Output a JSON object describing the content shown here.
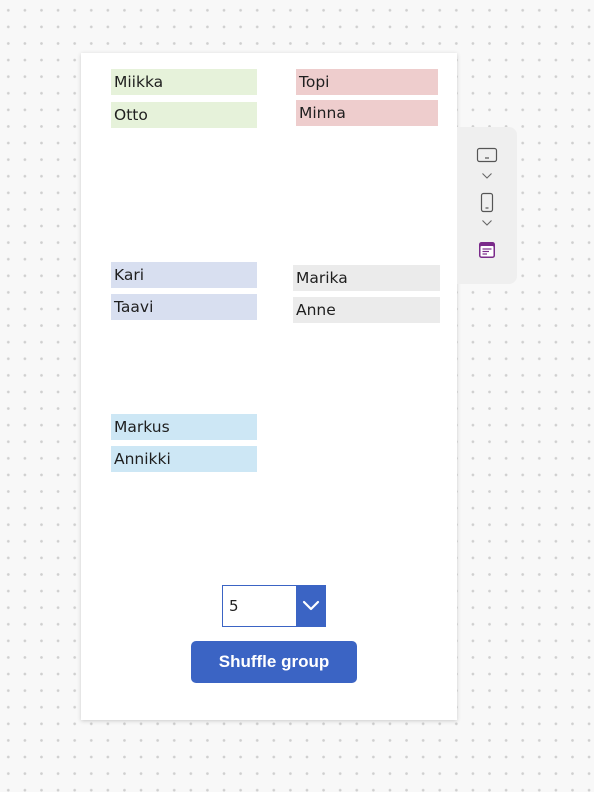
{
  "groups": [
    {
      "members": [
        "Miikka",
        "Otto"
      ],
      "color": "#e6f2da"
    },
    {
      "members": [
        "Topi",
        "Minna"
      ],
      "color": "#eecdcd"
    },
    {
      "members": [
        "Kari",
        "Taavi"
      ],
      "color": "#d8dff0"
    },
    {
      "members": [
        "Marika",
        "Anne"
      ],
      "color": "#ebebeb"
    },
    {
      "members": [
        "Markus",
        "Annikki"
      ],
      "color": "#cde7f5"
    }
  ],
  "group_count_dropdown": {
    "selected": "5"
  },
  "shuffle_button": {
    "label": "Shuffle group"
  },
  "side_toolbar": {
    "items": [
      {
        "icon": "tablet-layout-icon"
      },
      {
        "icon": "chevron-down-icon"
      },
      {
        "icon": "phone-layout-icon"
      },
      {
        "icon": "chevron-down-icon"
      },
      {
        "icon": "form-layout-icon"
      }
    ]
  },
  "colors": {
    "accent": "#3b64c4",
    "form_icon": "#7a2a8a"
  }
}
